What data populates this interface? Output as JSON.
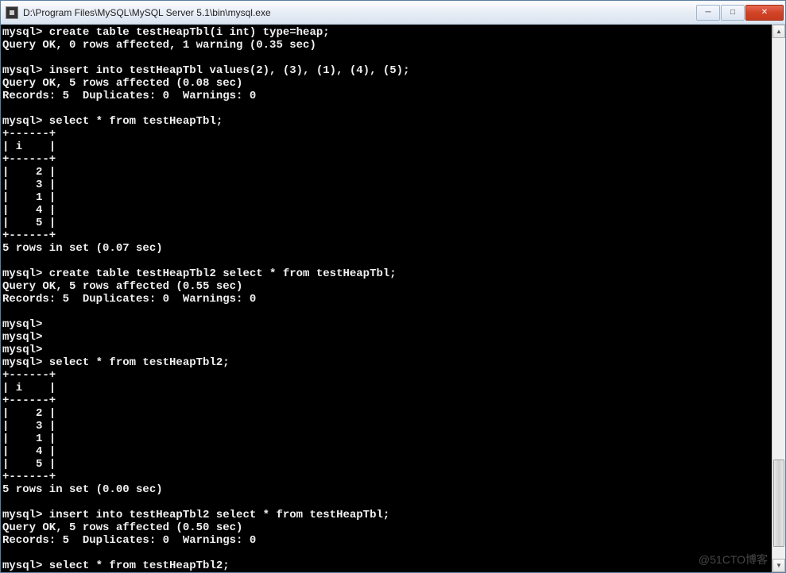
{
  "window": {
    "title": "D:\\Program Files\\MySQL\\MySQL Server 5.1\\bin\\mysql.exe"
  },
  "watermark": "@51CTO博客",
  "terminal": {
    "lines": [
      "mysql> create table testHeapTbl(i int) type=heap;",
      "Query OK, 0 rows affected, 1 warning (0.35 sec)",
      "",
      "mysql> insert into testHeapTbl values(2), (3), (1), (4), (5);",
      "Query OK, 5 rows affected (0.08 sec)",
      "Records: 5  Duplicates: 0  Warnings: 0",
      "",
      "mysql> select * from testHeapTbl;",
      "+------+",
      "| i    |",
      "+------+",
      "|    2 |",
      "|    3 |",
      "|    1 |",
      "|    4 |",
      "|    5 |",
      "+------+",
      "5 rows in set (0.07 sec)",
      "",
      "mysql> create table testHeapTbl2 select * from testHeapTbl;",
      "Query OK, 5 rows affected (0.55 sec)",
      "Records: 5  Duplicates: 0  Warnings: 0",
      "",
      "mysql>",
      "mysql>",
      "mysql>",
      "mysql> select * from testHeapTbl2;",
      "+------+",
      "| i    |",
      "+------+",
      "|    2 |",
      "|    3 |",
      "|    1 |",
      "|    4 |",
      "|    5 |",
      "+------+",
      "5 rows in set (0.00 sec)",
      "",
      "mysql> insert into testHeapTbl2 select * from testHeapTbl;",
      "Query OK, 5 rows affected (0.50 sec)",
      "Records: 5  Duplicates: 0  Warnings: 0",
      "",
      "mysql> select * from testHeapTbl2;"
    ]
  }
}
